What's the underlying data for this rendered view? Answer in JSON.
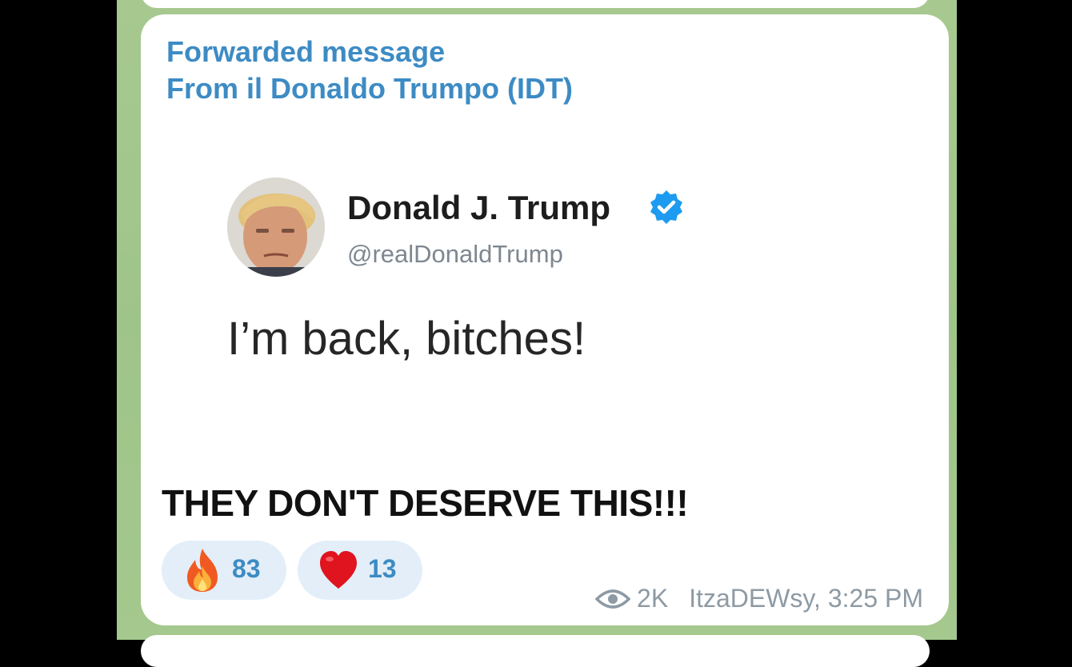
{
  "forward": {
    "header": "Forwarded message",
    "from": "From il Donaldo Trumpo (IDT)"
  },
  "tweet": {
    "name": "Donald J. Trump",
    "handle": "@realDonaldTrump",
    "text": "I’m back, bitches!",
    "verified_icon": "verified-badge-icon",
    "verified_color": "#1d9bf0"
  },
  "caption": "THEY DON'T DESERVE THIS!!!",
  "reactions": [
    {
      "emoji": "fire-icon",
      "count": "83"
    },
    {
      "emoji": "heart-icon",
      "count": "13"
    }
  ],
  "meta": {
    "views": "2K",
    "author_time": "ItzaDEWsy, 3:25 PM"
  },
  "colors": {
    "link": "#3d8bc4",
    "chat_bg": "#a4c88d",
    "reaction_bg": "#e3eef8",
    "meta": "#8d9aa4"
  }
}
